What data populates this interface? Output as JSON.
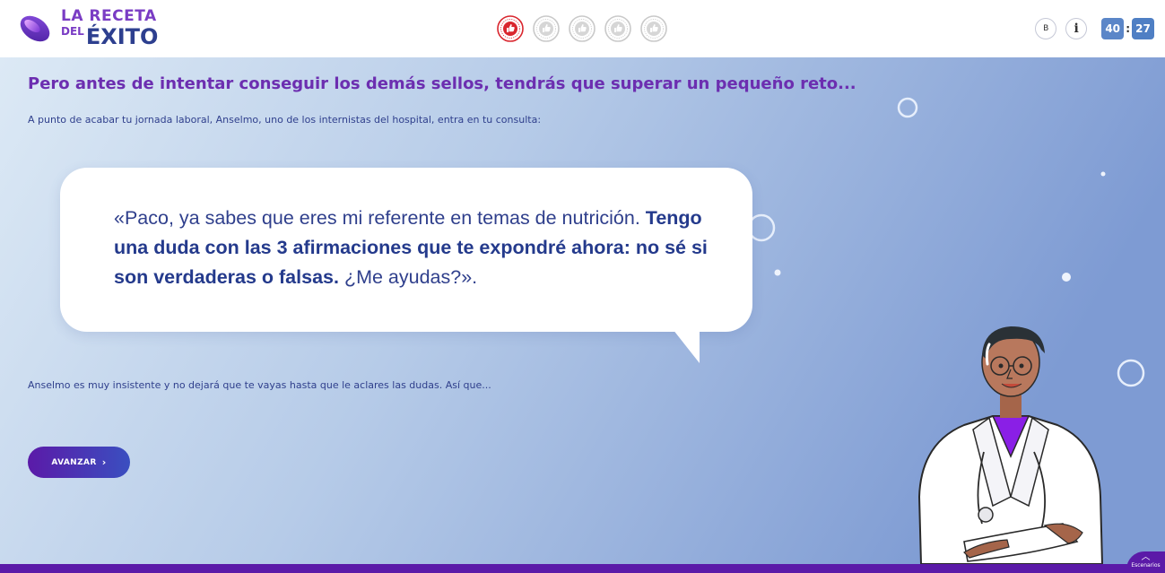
{
  "app": {
    "logo_line1": "LA RECETA",
    "logo_line2_small": "DEL",
    "logo_line2_big": "ÉXITO"
  },
  "seals": [
    {
      "id": "seal-1",
      "state": "earned",
      "icon": "thumbs-up-icon"
    },
    {
      "id": "seal-2",
      "state": "locked",
      "icon": "thumbs-up-icon"
    },
    {
      "id": "seal-3",
      "state": "locked",
      "icon": "thumbs-up-icon"
    },
    {
      "id": "seal-4",
      "state": "locked",
      "icon": "thumbs-up-icon"
    },
    {
      "id": "seal-5",
      "state": "locked",
      "icon": "thumbs-up-icon"
    }
  ],
  "header_controls": {
    "b_label": "B",
    "info_label": "i"
  },
  "timer": {
    "minutes": "40",
    "separator": ":",
    "seconds": "27"
  },
  "content": {
    "heading": "Pero antes de intentar conseguir los demás sellos, tendrás que superar un pequeño reto...",
    "intro": "A punto de acabar tu jornada laboral, Anselmo, uno de los internistas del hospital, entra en tu consulta:",
    "quote_part1": "«Paco, ya sabes que eres mi referente en temas de nutrición. ",
    "quote_part2_bold": "Tengo una duda con las 3 afirmaciones que te expondré ahora: no sé si son verdaderas o falsas.",
    "quote_part3": " ¿Me ayudas?».",
    "outro": "Anselmo es muy insistente y no dejará que te vayas hasta que le aclares las dudas. Así que..."
  },
  "actions": {
    "advance_label": "AVANZAR",
    "advance_chevron": "›"
  },
  "footer": {
    "scenarios_chevron": "︿",
    "scenarios_label": "Escenarios"
  },
  "colors": {
    "brand_purple": "#6c2eb0",
    "brand_navy": "#2f3f8c",
    "seal_earned": "#d9262e",
    "seal_locked": "#c9c9c9",
    "timer_bg": "#5b86c8"
  }
}
